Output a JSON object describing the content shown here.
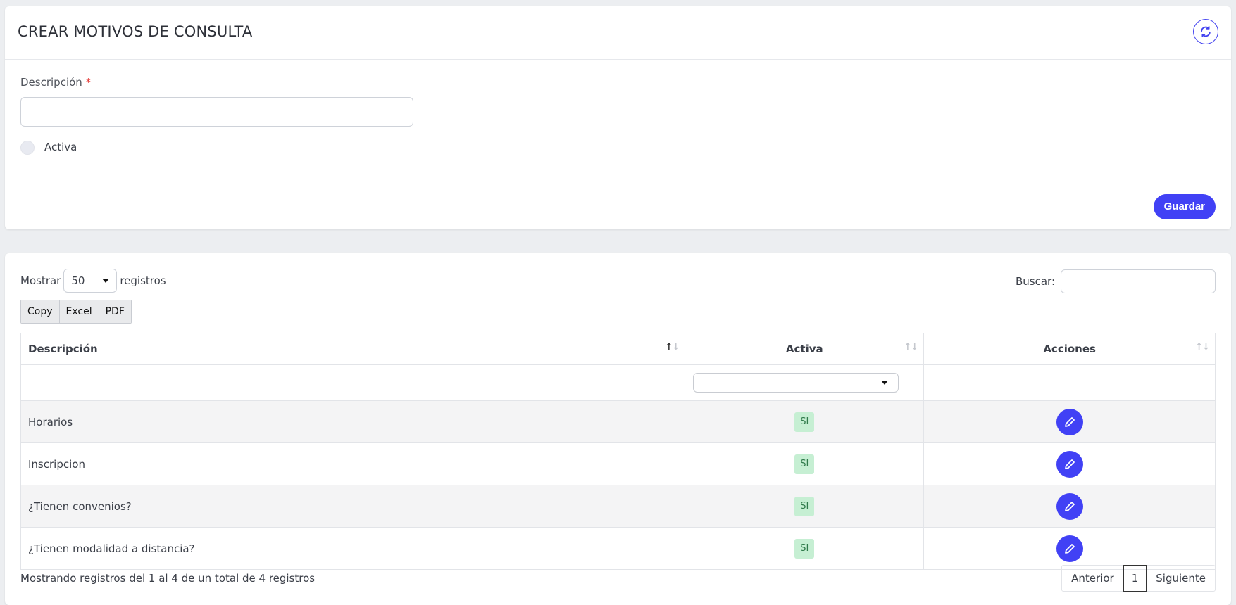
{
  "form": {
    "title": "CREAR MOTIVOS DE CONSULTA",
    "refresh_icon": "refresh-icon",
    "description_label": "Descripción",
    "required_mark": "*",
    "description_value": "",
    "active_label": "Activa",
    "active_checked": false,
    "save_label": "Guardar"
  },
  "table_controls": {
    "show_prefix": "Mostrar",
    "page_length": "50",
    "show_suffix": "registros",
    "search_label": "Buscar:",
    "search_value": "",
    "export_buttons": [
      "Copy",
      "Excel",
      "PDF"
    ]
  },
  "table": {
    "columns": [
      "Descripción",
      "Activa",
      "Acciones"
    ],
    "active_filter_value": "",
    "rows": [
      {
        "descripcion": "Horarios",
        "activa": "SI"
      },
      {
        "descripcion": "Inscripcion",
        "activa": "SI"
      },
      {
        "descripcion": "¿Tienen convenios?",
        "activa": "SI"
      },
      {
        "descripcion": "¿Tienen modalidad a distancia?",
        "activa": "SI"
      }
    ]
  },
  "footer": {
    "info": "Mostrando registros del 1 al 4 de un total de 4 registros",
    "prev_label": "Anterior",
    "current_page": "1",
    "next_label": "Siguiente"
  },
  "colors": {
    "accent": "#4141f5",
    "badge_bg": "#c6efd3",
    "badge_text": "#2f7a4a",
    "required": "#e53935"
  }
}
